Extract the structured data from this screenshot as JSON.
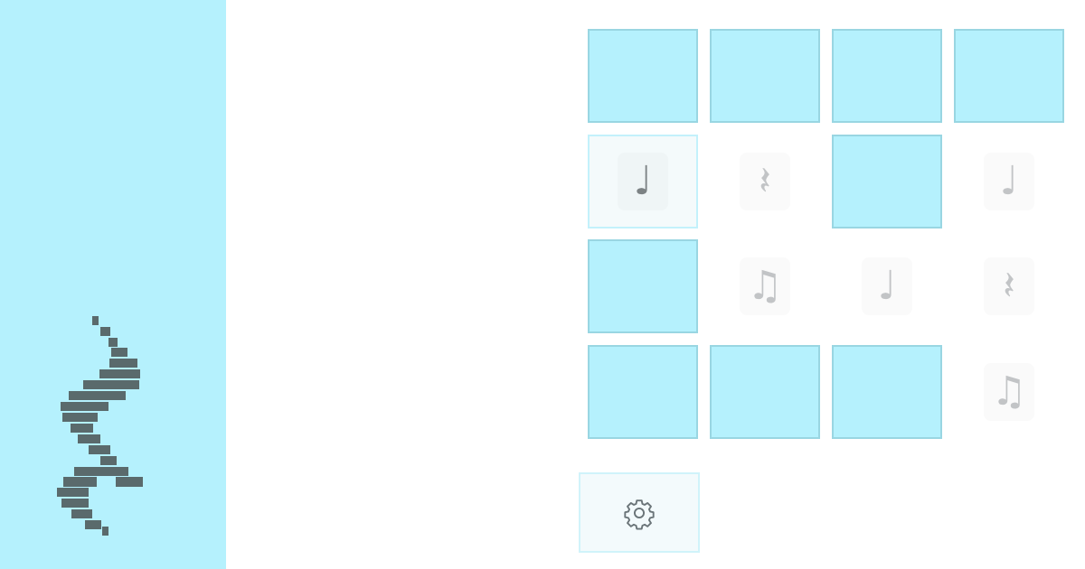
{
  "game": {
    "decoration_icon": "quarter-rest-pixel-icon",
    "settings_icon": "gear-icon"
  },
  "colors": {
    "panel": "#b5f1fd",
    "card_back": "#b5f1fd",
    "card_border": "#99d6e2",
    "selected_border": "#c3f1fb",
    "symbol_faded": "#c2c4c6",
    "symbol_active": "#7c8284",
    "pixel_art": "#5a6a6c"
  },
  "cards": [
    {
      "row": 1,
      "col": 1,
      "state": "facedown",
      "symbol": ""
    },
    {
      "row": 1,
      "col": 2,
      "state": "facedown",
      "symbol": ""
    },
    {
      "row": 1,
      "col": 3,
      "state": "facedown",
      "symbol": ""
    },
    {
      "row": 1,
      "col": 4,
      "state": "facedown",
      "symbol": ""
    },
    {
      "row": 2,
      "col": 1,
      "state": "selected",
      "symbol": "♩",
      "symbol_name": "quarter-note-icon"
    },
    {
      "row": 2,
      "col": 2,
      "state": "faceup",
      "symbol": "𝄽",
      "symbol_name": "quarter-rest-icon"
    },
    {
      "row": 2,
      "col": 3,
      "state": "facedown",
      "symbol": ""
    },
    {
      "row": 2,
      "col": 4,
      "state": "faceup",
      "symbol": "♩",
      "symbol_name": "quarter-note-icon"
    },
    {
      "row": 3,
      "col": 1,
      "state": "facedown",
      "symbol": ""
    },
    {
      "row": 3,
      "col": 2,
      "state": "faceup",
      "symbol": "♫",
      "symbol_name": "eighth-notes-icon"
    },
    {
      "row": 3,
      "col": 3,
      "state": "faceup",
      "symbol": "♩",
      "symbol_name": "quarter-note-icon"
    },
    {
      "row": 3,
      "col": 4,
      "state": "faceup",
      "symbol": "𝄽",
      "symbol_name": "quarter-rest-icon"
    },
    {
      "row": 4,
      "col": 1,
      "state": "facedown",
      "symbol": ""
    },
    {
      "row": 4,
      "col": 2,
      "state": "facedown",
      "symbol": ""
    },
    {
      "row": 4,
      "col": 3,
      "state": "facedown",
      "symbol": ""
    },
    {
      "row": 4,
      "col": 4,
      "state": "faceup",
      "symbol": "♫",
      "symbol_name": "eighth-notes-icon"
    }
  ]
}
